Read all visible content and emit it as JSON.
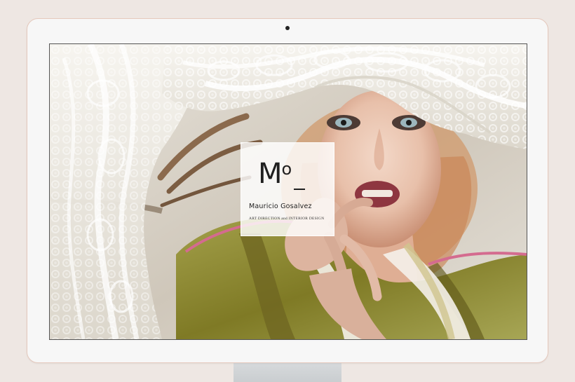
{
  "brand": {
    "mark_letter": "M",
    "mark_small": "o",
    "name": "Mauricio Gosalvez",
    "tagline": "ART DIRECTION and INTERIOR DESIGN"
  },
  "colors": {
    "page_background": "#eee7e3",
    "monitor_bezel": "#f7f7f7",
    "monitor_outline": "#e5c9bd",
    "logo_text": "#1f1f1f",
    "jacket_green": "#8d8a33",
    "lace_white": "#f2f0ea"
  },
  "icons": {
    "camera": "camera-dot-icon",
    "monogram": "mo-monogram-logo"
  }
}
